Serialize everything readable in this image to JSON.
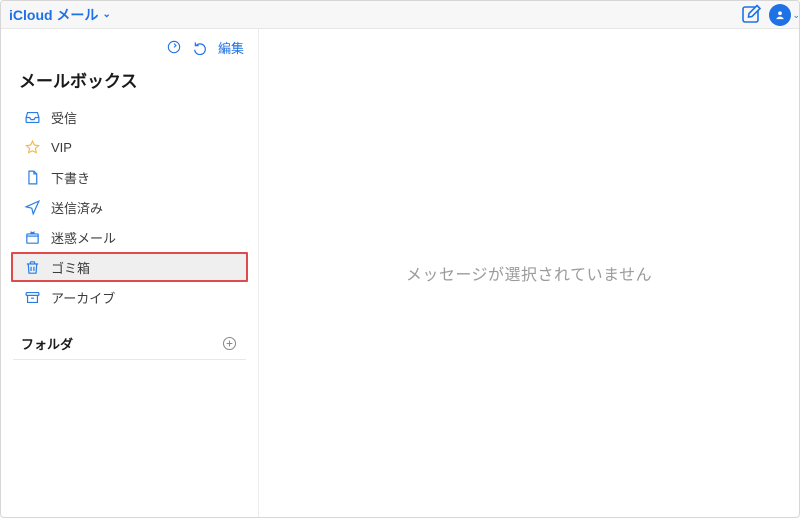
{
  "colors": {
    "accent": "#1f72e5",
    "highlightBorder": "#e04a4a",
    "muted": "#9b9b9b"
  },
  "header": {
    "title": "iCloud メール",
    "composeIcon": "compose-icon",
    "accountIcon": "person-circle-icon"
  },
  "sidebar": {
    "tools": {
      "refreshIcon": "refresh-circle-icon",
      "undoIcon": "undo-icon",
      "editLabel": "編集"
    },
    "sectionTitle": "メールボックス",
    "items": [
      {
        "icon": "inbox-icon",
        "label": "受信",
        "highlighted": false
      },
      {
        "icon": "star-icon",
        "label": "VIP",
        "highlighted": false
      },
      {
        "icon": "file-icon",
        "label": "下書き",
        "highlighted": false
      },
      {
        "icon": "send-icon",
        "label": "送信済み",
        "highlighted": false
      },
      {
        "icon": "junk-icon",
        "label": "迷惑メール",
        "highlighted": false
      },
      {
        "icon": "trash-icon",
        "label": "ゴミ箱",
        "highlighted": true
      },
      {
        "icon": "archive-icon",
        "label": "アーカイブ",
        "highlighted": false
      }
    ],
    "foldersLabel": "フォルダ",
    "addFolderIcon": "plus-circle-icon"
  },
  "content": {
    "emptyMessage": "メッセージが選択されていません"
  }
}
